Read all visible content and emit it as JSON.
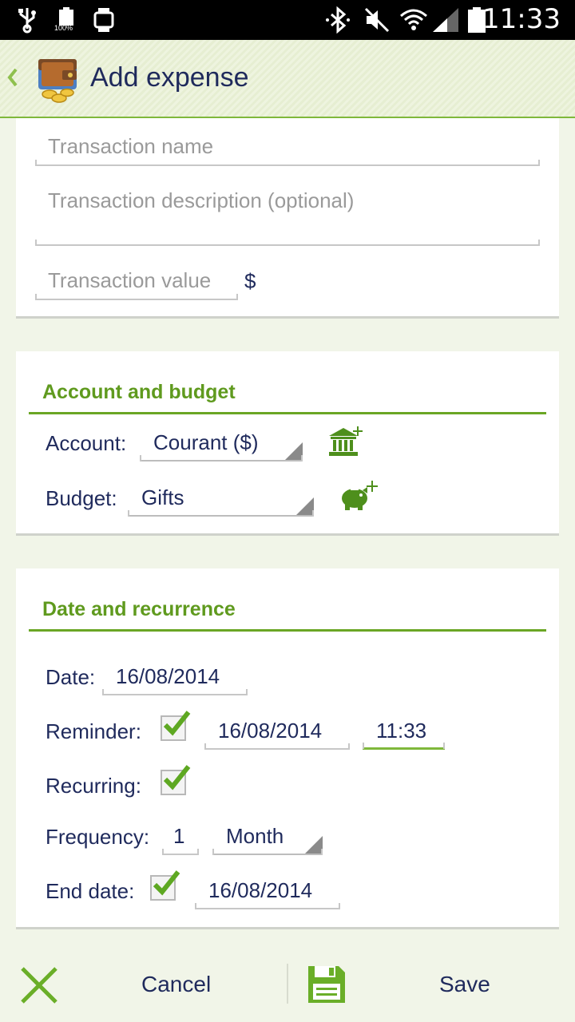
{
  "status_bar": {
    "time": "11:33",
    "battery_text": "100%",
    "icons": [
      "usb-icon",
      "battery-saver-icon",
      "watch-icon",
      "bluetooth-icon",
      "mute-icon",
      "wifi-icon",
      "signal-icon",
      "battery-icon"
    ]
  },
  "header": {
    "title": "Add expense",
    "logo_icon": "wallet-coins-icon",
    "accent": "#7fb83b"
  },
  "transaction": {
    "name_placeholder": "Transaction name",
    "description_placeholder": "Transaction description (optional)",
    "value_placeholder": "Transaction value",
    "currency": "$"
  },
  "account_budget": {
    "title": "Account and budget",
    "account_label": "Account:",
    "account_value": "Courant ($)",
    "budget_label": "Budget:",
    "budget_value": "Gifts",
    "add_account_icon": "bank-add-icon",
    "add_budget_icon": "piggy-bank-add-icon"
  },
  "date_recurrence": {
    "title": "Date and recurrence",
    "date_label": "Date:",
    "date_value": "16/08/2014",
    "reminder_label": "Reminder:",
    "reminder_checked": true,
    "reminder_date": "16/08/2014",
    "reminder_time": "11:33",
    "recurring_label": "Recurring:",
    "recurring_checked": true,
    "frequency_label": "Frequency:",
    "frequency_value": "1",
    "frequency_unit": "Month",
    "end_date_label": "End date:",
    "end_date_checked": true,
    "end_date_value": "16/08/2014"
  },
  "actions": {
    "cancel_label": "Cancel",
    "save_label": "Save",
    "cancel_icon": "close-icon",
    "save_icon": "floppy-disk-icon"
  },
  "colors": {
    "section_green": "#5f9a1e",
    "text_navy": "#1f2a5c",
    "placeholder_gray": "#9a9a9a",
    "background": "#f1f5e8"
  }
}
